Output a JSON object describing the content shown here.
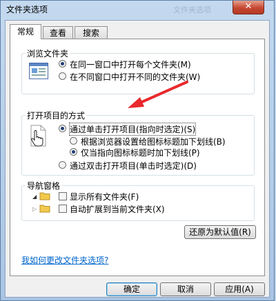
{
  "window": {
    "title": "文件夹选项",
    "background_title": "文件夹选项",
    "close_glyph": "✕"
  },
  "tabs": [
    {
      "label": "常规"
    },
    {
      "label": "查看"
    },
    {
      "label": "搜索"
    }
  ],
  "browse": {
    "title": "浏览文件夹",
    "options": [
      {
        "label": "在同一窗口中打开每个文件夹(M)",
        "selected": true
      },
      {
        "label": "在不同窗口中打开不同的文件夹(W)",
        "selected": false
      }
    ]
  },
  "click_items": {
    "title": "打开项目的方式",
    "single_click": {
      "label": "通过单击打开项目(指向时选定)(S)",
      "selected": true
    },
    "underline_browser": {
      "label": "根据浏览器设置给图标标题加下划线(B)",
      "selected": false
    },
    "underline_point": {
      "label": "仅当指向图标标题时加下划线(P)",
      "selected": true
    },
    "double_click": {
      "label": "通过双击打开项目(单击时选定)(D)",
      "selected": false
    }
  },
  "nav_pane": {
    "title": "导航窗格",
    "options": [
      {
        "label": "显示所有文件夹(F)",
        "checked": false
      },
      {
        "label": "自动扩展到当前文件夹(X)",
        "checked": false
      }
    ]
  },
  "restore_defaults": "还原为默认值(R)",
  "help_link": "我如何更改文件夹选项?",
  "footer": {
    "ok": "确定",
    "cancel": "取消",
    "apply": "应用(A)"
  },
  "colors": {
    "arrow": "#e8292d",
    "link": "#0066cc",
    "selected_radio": "#1e3f74"
  }
}
